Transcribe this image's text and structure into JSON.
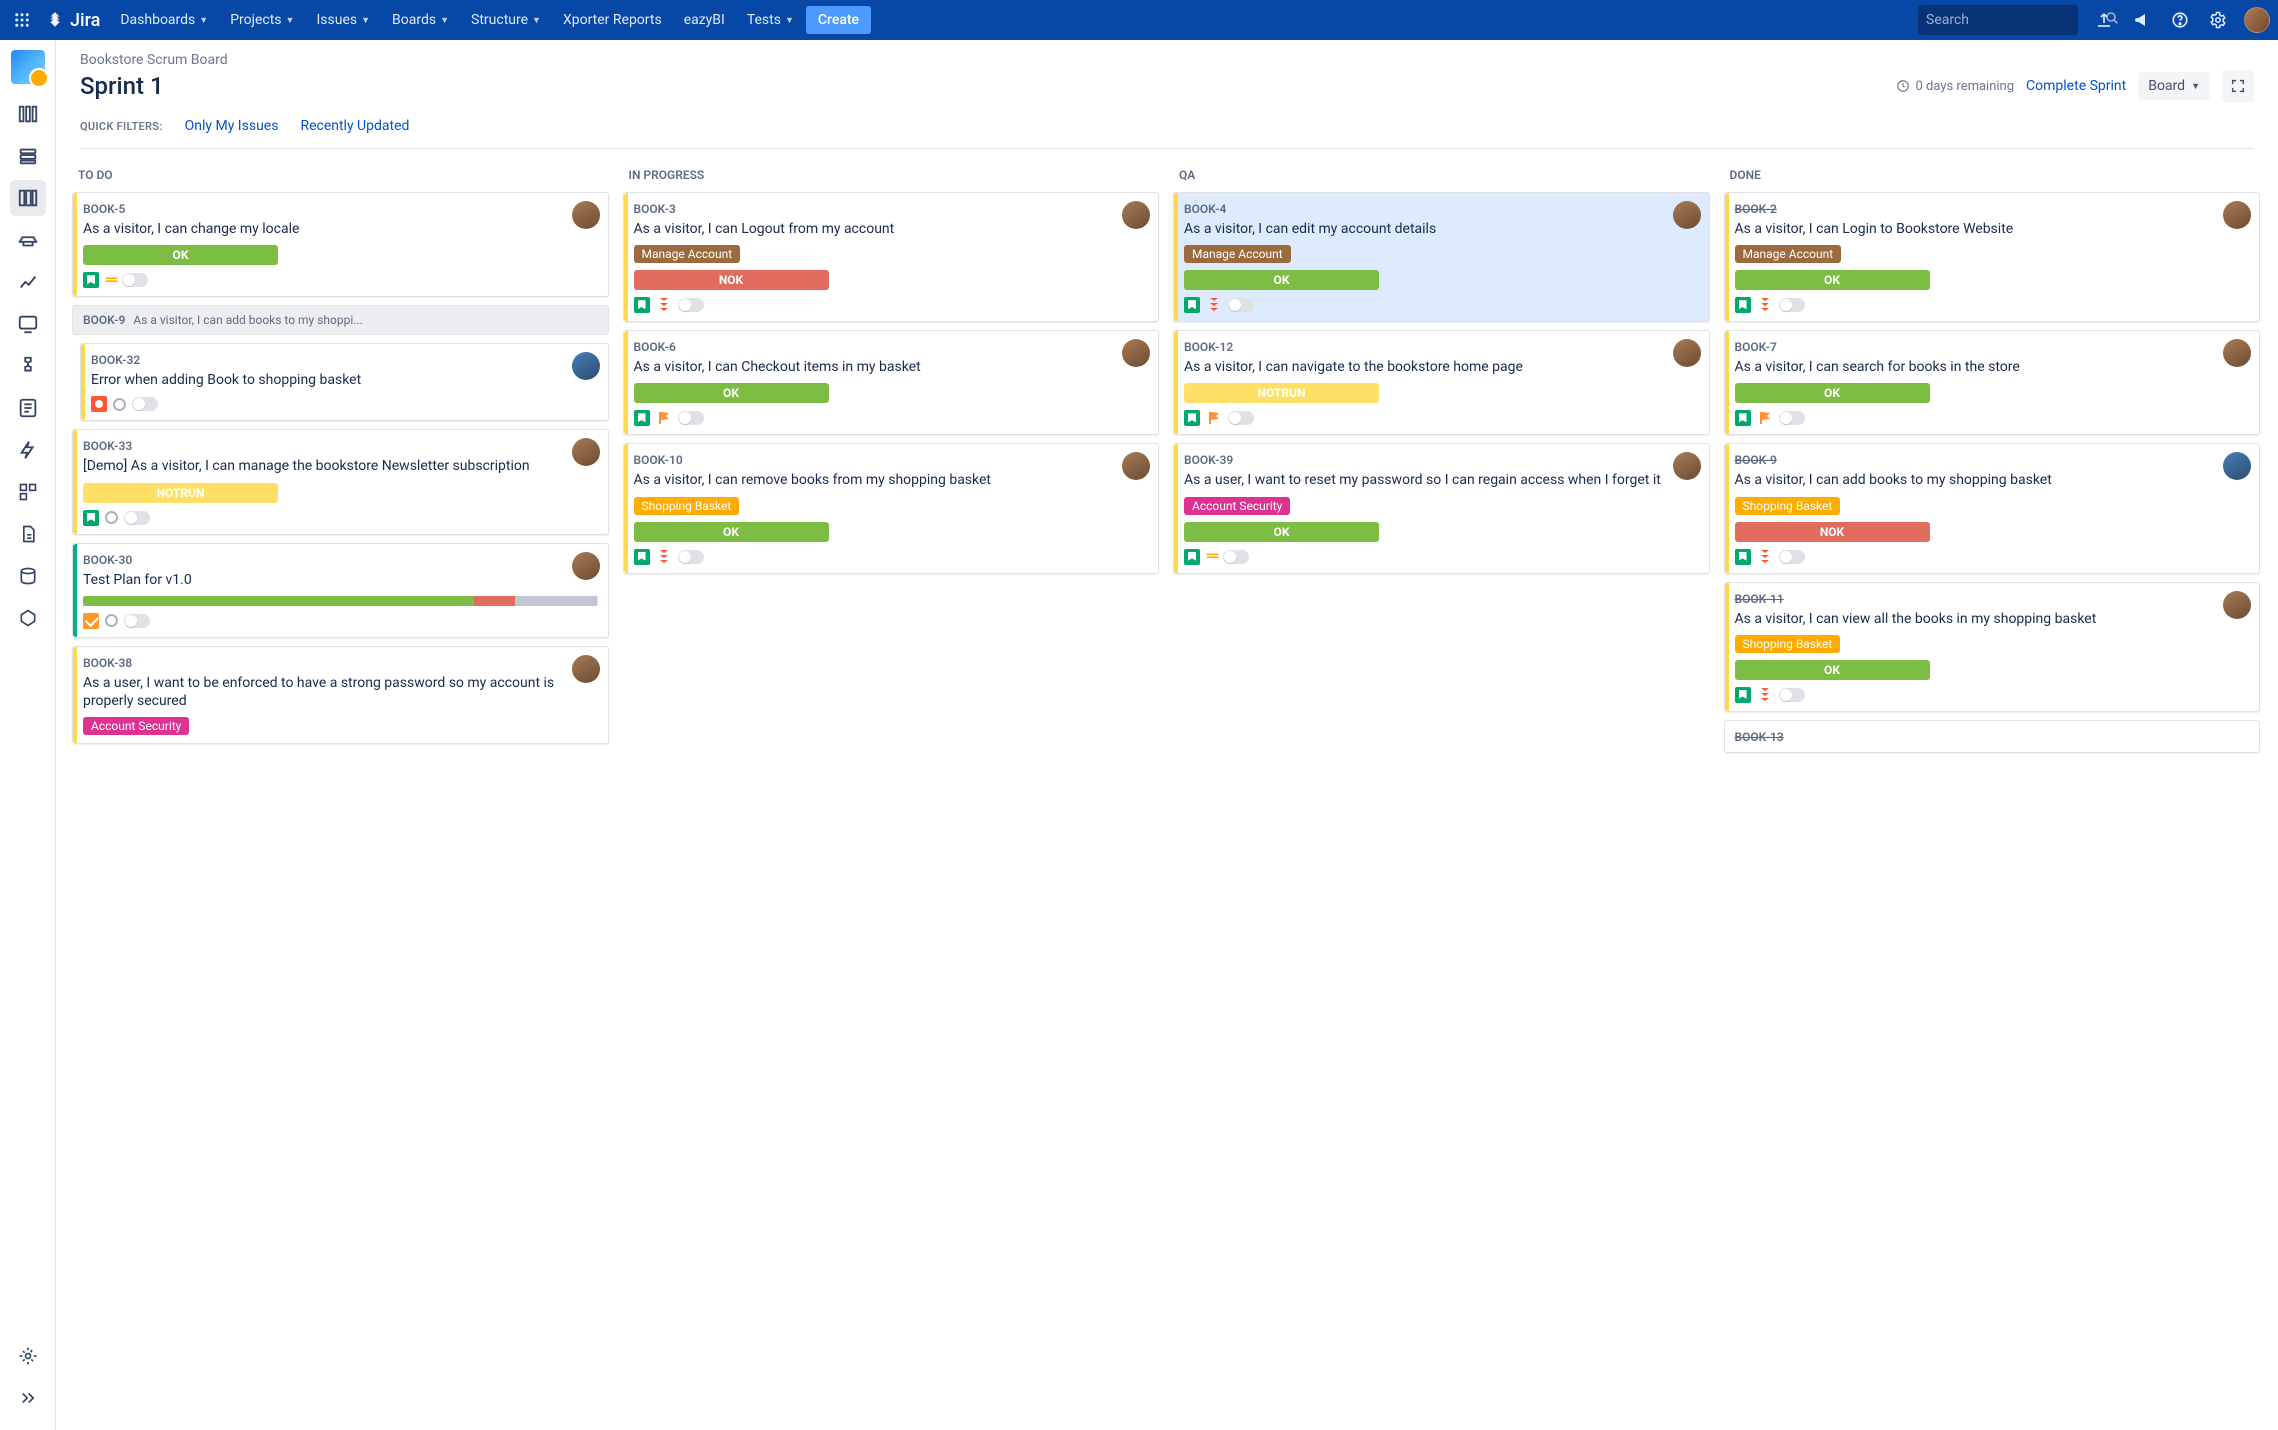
{
  "app": {
    "logo_text": "Jira"
  },
  "nav_items": [
    {
      "label": "Dashboards",
      "dd": true
    },
    {
      "label": "Projects",
      "dd": true
    },
    {
      "label": "Issues",
      "dd": true
    },
    {
      "label": "Boards",
      "dd": true
    },
    {
      "label": "Structure",
      "dd": true
    },
    {
      "label": "Xporter Reports",
      "dd": false
    },
    {
      "label": "eazyBI",
      "dd": false
    },
    {
      "label": "Tests",
      "dd": true
    }
  ],
  "create_label": "Create",
  "search": {
    "placeholder": "Search"
  },
  "header": {
    "crumb": "Bookstore Scrum Board",
    "title": "Sprint 1",
    "remaining": "0 days remaining",
    "complete": "Complete Sprint",
    "board_dd": "Board",
    "filters_label": "QUICK FILTERS:",
    "filters": [
      "Only My Issues",
      "Recently Updated"
    ]
  },
  "columns": [
    {
      "title": "TO DO",
      "cards": [
        {
          "key": "BOOK-5",
          "summary": "As a visitor, I can change my locale",
          "status": "OK",
          "stripe": "yellow",
          "avatar": "a",
          "type": "story",
          "prio": "eq"
        },
        {
          "group": {
            "key": "BOOK-9",
            "summary": "As a visitor, I can add books to my shoppi..."
          },
          "children": [
            {
              "key": "BOOK-32",
              "summary": "Error when adding Book to shopping basket",
              "stripe": "yellow",
              "avatar": "sun",
              "type": "bug",
              "prio": "circle"
            }
          ]
        },
        {
          "key": "BOOK-33",
          "summary": "[Demo] As a visitor, I can manage the bookstore Newsletter subscription",
          "status": "NOTRUN",
          "stripe": "yellow",
          "avatar": "a",
          "type": "story",
          "prio": "circle"
        },
        {
          "key": "BOOK-30",
          "summary": "Test Plan for v1.0",
          "prog": [
            {
              "c": "#7ebd43",
              "w": 76
            },
            {
              "c": "#e06c5e",
              "w": 8
            },
            {
              "c": "#c1c7d0",
              "w": 16
            }
          ],
          "stripe": "teal",
          "avatar": "a",
          "type": "plan",
          "prio": "circle"
        },
        {
          "key": "BOOK-38",
          "summary": "As a user, I want to be enforced to have a strong password so my account is properly secured",
          "epic": "Account Security",
          "epic_cls": "as",
          "stripe": "yellow",
          "avatar": "a"
        }
      ]
    },
    {
      "title": "IN PROGRESS",
      "cards": [
        {
          "key": "BOOK-3",
          "summary": "As a visitor, I can Logout from my account",
          "epic": "Manage Account",
          "epic_cls": "ma",
          "status": "NOK",
          "stripe": "yellow",
          "avatar": "a",
          "type": "story",
          "prio": "high"
        },
        {
          "key": "BOOK-6",
          "summary": "As a visitor, I can Checkout items in my basket",
          "status": "OK",
          "stripe": "yellow",
          "avatar": "a",
          "type": "story",
          "prio": "flag"
        },
        {
          "key": "BOOK-10",
          "summary": "As a visitor, I can remove books from my shopping basket",
          "epic": "Shopping Basket",
          "epic_cls": "sb",
          "status": "OK",
          "stripe": "yellow",
          "avatar": "a",
          "type": "story",
          "prio": "high"
        }
      ]
    },
    {
      "title": "QA",
      "cards": [
        {
          "key": "BOOK-4",
          "summary": "As a visitor, I can edit my account details",
          "epic": "Manage Account",
          "epic_cls": "ma",
          "status": "OK",
          "stripe": "yellow",
          "avatar": "a",
          "type": "story",
          "prio": "high",
          "selected": true
        },
        {
          "key": "BOOK-12",
          "summary": "As a visitor, I can navigate to the bookstore home page",
          "status": "NOTRUN",
          "stripe": "yellow",
          "avatar": "a",
          "type": "story",
          "prio": "flag"
        },
        {
          "key": "BOOK-39",
          "summary": "As a user, I want to reset my password so I can regain access when I forget it",
          "epic": "Account Security",
          "epic_cls": "as",
          "status": "OK",
          "stripe": "yellow",
          "avatar": "a",
          "type": "story",
          "prio": "eq"
        }
      ]
    },
    {
      "title": "DONE",
      "cards": [
        {
          "key": "BOOK-2",
          "done": true,
          "summary": "As a visitor, I can Login to Bookstore Website",
          "epic": "Manage Account",
          "epic_cls": "ma",
          "status": "OK",
          "stripe": "yellow",
          "avatar": "a",
          "type": "story",
          "prio": "high"
        },
        {
          "key": "BOOK-7",
          "summary": "As a visitor, I can search for books in the store",
          "status": "OK",
          "stripe": "yellow",
          "avatar": "a",
          "type": "story",
          "prio": "flag"
        },
        {
          "key": "BOOK-9",
          "done": true,
          "summary": "As a visitor, I can add books to my shopping basket",
          "epic": "Shopping Basket",
          "epic_cls": "sb",
          "status": "NOK",
          "stripe": "yellow",
          "avatar": "sun",
          "type": "story",
          "prio": "high"
        },
        {
          "key": "BOOK-11",
          "done": true,
          "summary": "As a visitor, I can view all the books in my shopping basket",
          "epic": "Shopping Basket",
          "epic_cls": "sb",
          "status": "OK",
          "stripe": "yellow",
          "avatar": "a",
          "type": "story",
          "prio": "high"
        },
        {
          "key": "BOOK-13",
          "done": true
        }
      ]
    }
  ]
}
